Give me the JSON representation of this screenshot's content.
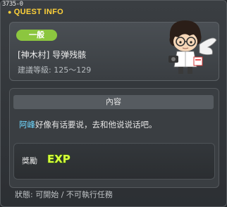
{
  "window": {
    "id_tag": "3735-0",
    "title": "QUEST INFO"
  },
  "quest": {
    "badge": "一般",
    "name": "[神木村] 导弹残骸",
    "level_range": "建議等級: 125～129"
  },
  "content": {
    "header": "內容",
    "npc_name": "阿峰",
    "description_rest": "好像有话要说，去和他说说话吧。"
  },
  "reward": {
    "label": "獎勵",
    "icon": "exp-icon",
    "icon_text": "EXP"
  },
  "status": {
    "text": "狀態:  可開始  / 不可執行任務"
  },
  "colors": {
    "title": "#ffd23a",
    "badge": "#8cc63f",
    "npc": "#6fd8ff",
    "exp": "#d7ff3a"
  }
}
